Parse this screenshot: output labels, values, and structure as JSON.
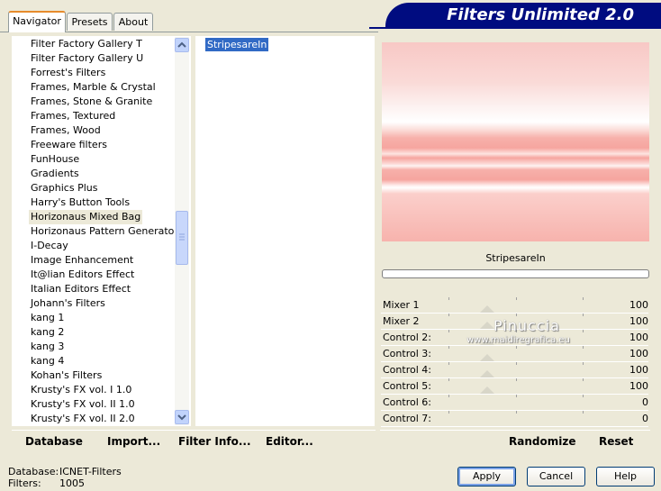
{
  "tabs": [
    {
      "label": "Navigator"
    },
    {
      "label": "Presets"
    },
    {
      "label": "About"
    }
  ],
  "banner_title": "Filters Unlimited 2.0",
  "categories": [
    "Filter Factory Gallery T",
    "Filter Factory Gallery U",
    "Forrest's Filters",
    "Frames, Marble & Crystal",
    "Frames, Stone & Granite",
    "Frames, Textured",
    "Frames, Wood",
    "Freeware filters",
    "FunHouse",
    "Gradients",
    "Graphics Plus",
    "Harry's Button Tools",
    "Horizonaus Mixed Bag",
    "Horizonaus Pattern Generators",
    "I-Decay",
    "Image Enhancement",
    "It@lian Editors Effect",
    "Italian Editors Effect",
    "Johann's Filters",
    "kang 1",
    "kang 2",
    "kang 3",
    "kang 4",
    "Kohan's Filters",
    "Krusty's FX vol. I 1.0",
    "Krusty's FX vol. II 1.0",
    "Krusty's FX vol. II 2.0"
  ],
  "selected_category_index": 12,
  "filters": [
    "StripesareIn"
  ],
  "filter_name": "StripesareIn",
  "controls": [
    {
      "label": "Mixer 1",
      "value": "100"
    },
    {
      "label": "Mixer 2",
      "value": "100"
    },
    {
      "label": "Control 2:",
      "value": "100"
    },
    {
      "label": "Control 3:",
      "value": "100"
    },
    {
      "label": "Control 4:",
      "value": "100"
    },
    {
      "label": "Control 5:",
      "value": "100"
    },
    {
      "label": "Control 6:",
      "value": "0"
    },
    {
      "label": "Control 7:",
      "value": "0"
    }
  ],
  "watermark": {
    "name": "Pinuccia",
    "url": "www.maidiregrafica.eu"
  },
  "toolbar": {
    "database": "Database",
    "import": "Import...",
    "filter_info": "Filter Info...",
    "editor": "Editor...",
    "randomize": "Randomize",
    "reset": "Reset"
  },
  "status": {
    "database_label": "Database:",
    "database_value": "ICNET-Filters",
    "filters_label": "Filters:",
    "filters_value": "1005"
  },
  "buttons": {
    "apply": "Apply",
    "cancel": "Cancel",
    "help": "Help"
  }
}
